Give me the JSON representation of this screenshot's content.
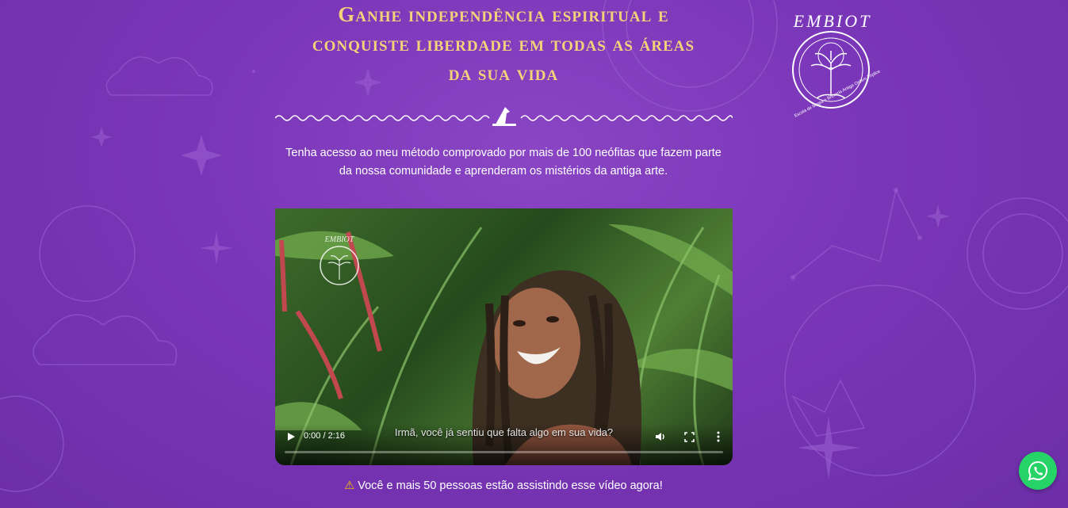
{
  "hero": {
    "headline_line1": "Ganhe independência espiritual e",
    "headline_line2": "conquiste liberdade em todas as áreas",
    "headline_line3": "da sua vida",
    "intro_line1": "Tenha acesso ao meu método comprovado por mais de 100 neófitas que fazem parte",
    "intro_line2": "da nossa comunidade e aprenderam os mistérios da antiga arte."
  },
  "logo": {
    "name": "EMBIOT",
    "tagline": "Escola de Magia e Bruxaria Antiga Ordem Tríplice"
  },
  "video": {
    "time": "0:00 / 2:16",
    "subtitle": "Irmã, você já sentiu que falta algo em sua vida?",
    "progress": 0,
    "icons": [
      "play-icon",
      "volume-icon",
      "fullscreen-icon",
      "more-options-icon"
    ]
  },
  "watching": {
    "text": "Você e mais 50 pessoas estão assistindo esse vídeo agora!"
  },
  "colors": {
    "background": "#7a36b8",
    "headline": "#f5d27a",
    "whatsapp": "#25d366"
  }
}
